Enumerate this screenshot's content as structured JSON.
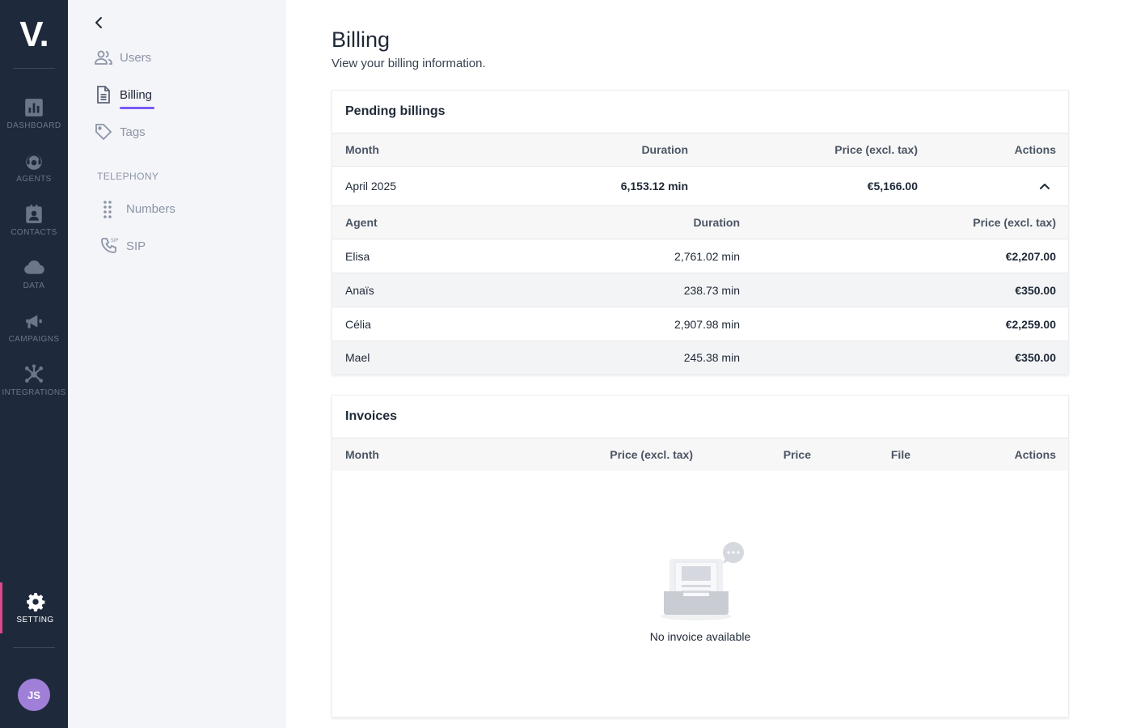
{
  "rail": {
    "logo": "V.",
    "items": [
      {
        "label": "DASHBOARD"
      },
      {
        "label": "AGENTS"
      },
      {
        "label": "CONTACTS"
      },
      {
        "label": "DATA"
      },
      {
        "label": "CAMPAIGNS"
      },
      {
        "label": "INTEGRATIONS"
      }
    ],
    "setting": {
      "label": "SETTING"
    },
    "avatar": "JS"
  },
  "subnav": {
    "items": [
      {
        "label": "Users",
        "icon": "users-icon"
      },
      {
        "label": "Billing",
        "icon": "document-icon",
        "active": true
      },
      {
        "label": "Tags",
        "icon": "tag-icon"
      }
    ],
    "telephony_title": "TELEPHONY",
    "telephony_items": [
      {
        "label": "Numbers",
        "icon": "keypad-icon"
      },
      {
        "label": "SIP",
        "icon": "sip-phone-icon"
      }
    ]
  },
  "page": {
    "title": "Billing",
    "subtitle": "View your billing information."
  },
  "pending": {
    "title": "Pending billings",
    "columns": [
      "Month",
      "Duration",
      "Price (excl. tax)",
      "Actions"
    ],
    "row": {
      "month": "April 2025",
      "duration": "6,153.12 min",
      "price": "€5,166.00"
    },
    "detail_columns": [
      "Agent",
      "Duration",
      "Price (excl. tax)"
    ],
    "agents": [
      {
        "name": "Elisa",
        "duration": "2,761.02 min",
        "price": "€2,207.00"
      },
      {
        "name": "Anaïs",
        "duration": "238.73 min",
        "price": "€350.00"
      },
      {
        "name": "Célia",
        "duration": "2,907.98 min",
        "price": "€2,259.00"
      },
      {
        "name": "Mael",
        "duration": "245.38 min",
        "price": "€350.00"
      }
    ]
  },
  "invoices": {
    "title": "Invoices",
    "columns": [
      "Month",
      "Price (excl. tax)",
      "Price",
      "File",
      "Actions"
    ],
    "empty_text": "No invoice available"
  },
  "colors": {
    "rail_bg": "#1e2a3b",
    "accent_pink": "#e0478b",
    "accent_purple": "#7a5af8",
    "avatar_bg": "#a07fd8"
  }
}
